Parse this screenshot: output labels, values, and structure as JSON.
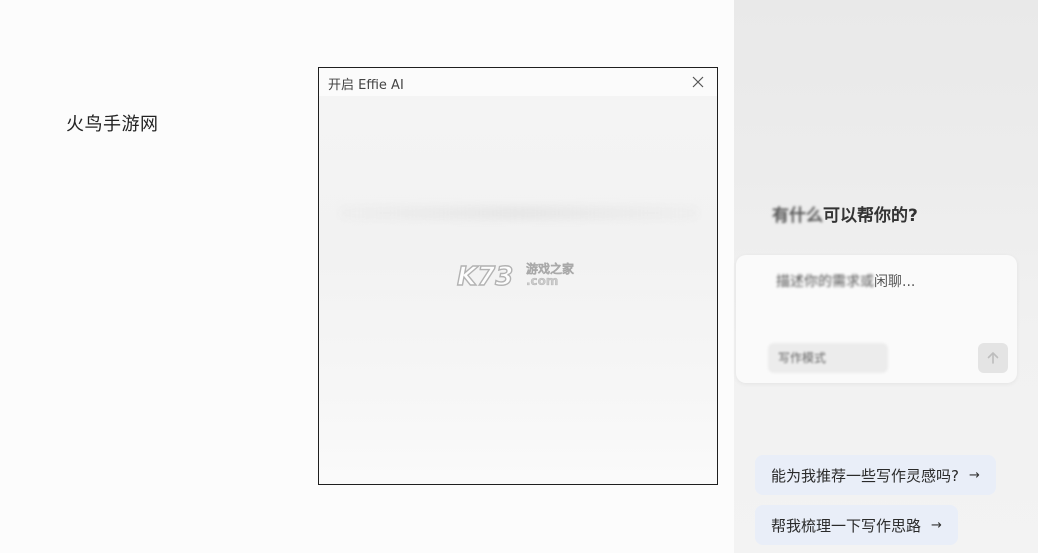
{
  "site_label": "火鸟手游网",
  "dialog": {
    "title": "开启 Effie AI",
    "watermark": {
      "brand": "K73",
      "cn": "游戏之家",
      "domain": ".com"
    }
  },
  "panel": {
    "greeting_blurred": "有什么",
    "greeting_tail": "可以帮你的?",
    "input": {
      "placeholder_blurred": "描述你的需求或",
      "placeholder_tail": "闲聊..."
    },
    "mode_chip": "写作模式",
    "suggestions": [
      {
        "label": "能为我推荐一些写作灵感吗?",
        "arrow": "→"
      },
      {
        "label": "帮我梳理一下写作思路",
        "arrow": "→"
      }
    ]
  }
}
